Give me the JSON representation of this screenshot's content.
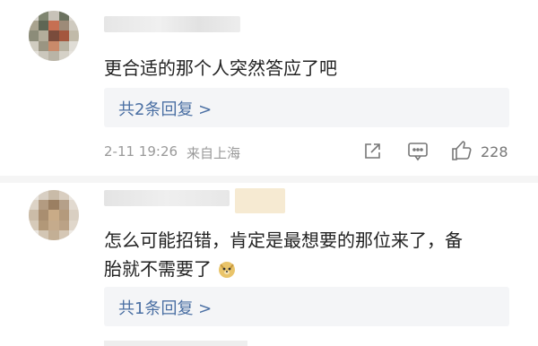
{
  "comments": [
    {
      "text": "更合适的那个人突然答应了吧",
      "reply_link": "共2条回复 >",
      "date": "2-11 19:26",
      "location": "来自上海",
      "likes": "228"
    },
    {
      "text_line1": "怎么可能招错，肯定是最想要的那位来了，备",
      "text_line2": "胎就不需要了",
      "emoji": "doge-emoji",
      "reply_link": "共1条回复 >"
    }
  ],
  "icons": {
    "share": "share-icon",
    "comment": "comment-icon",
    "like": "thumbs-up-icon"
  }
}
